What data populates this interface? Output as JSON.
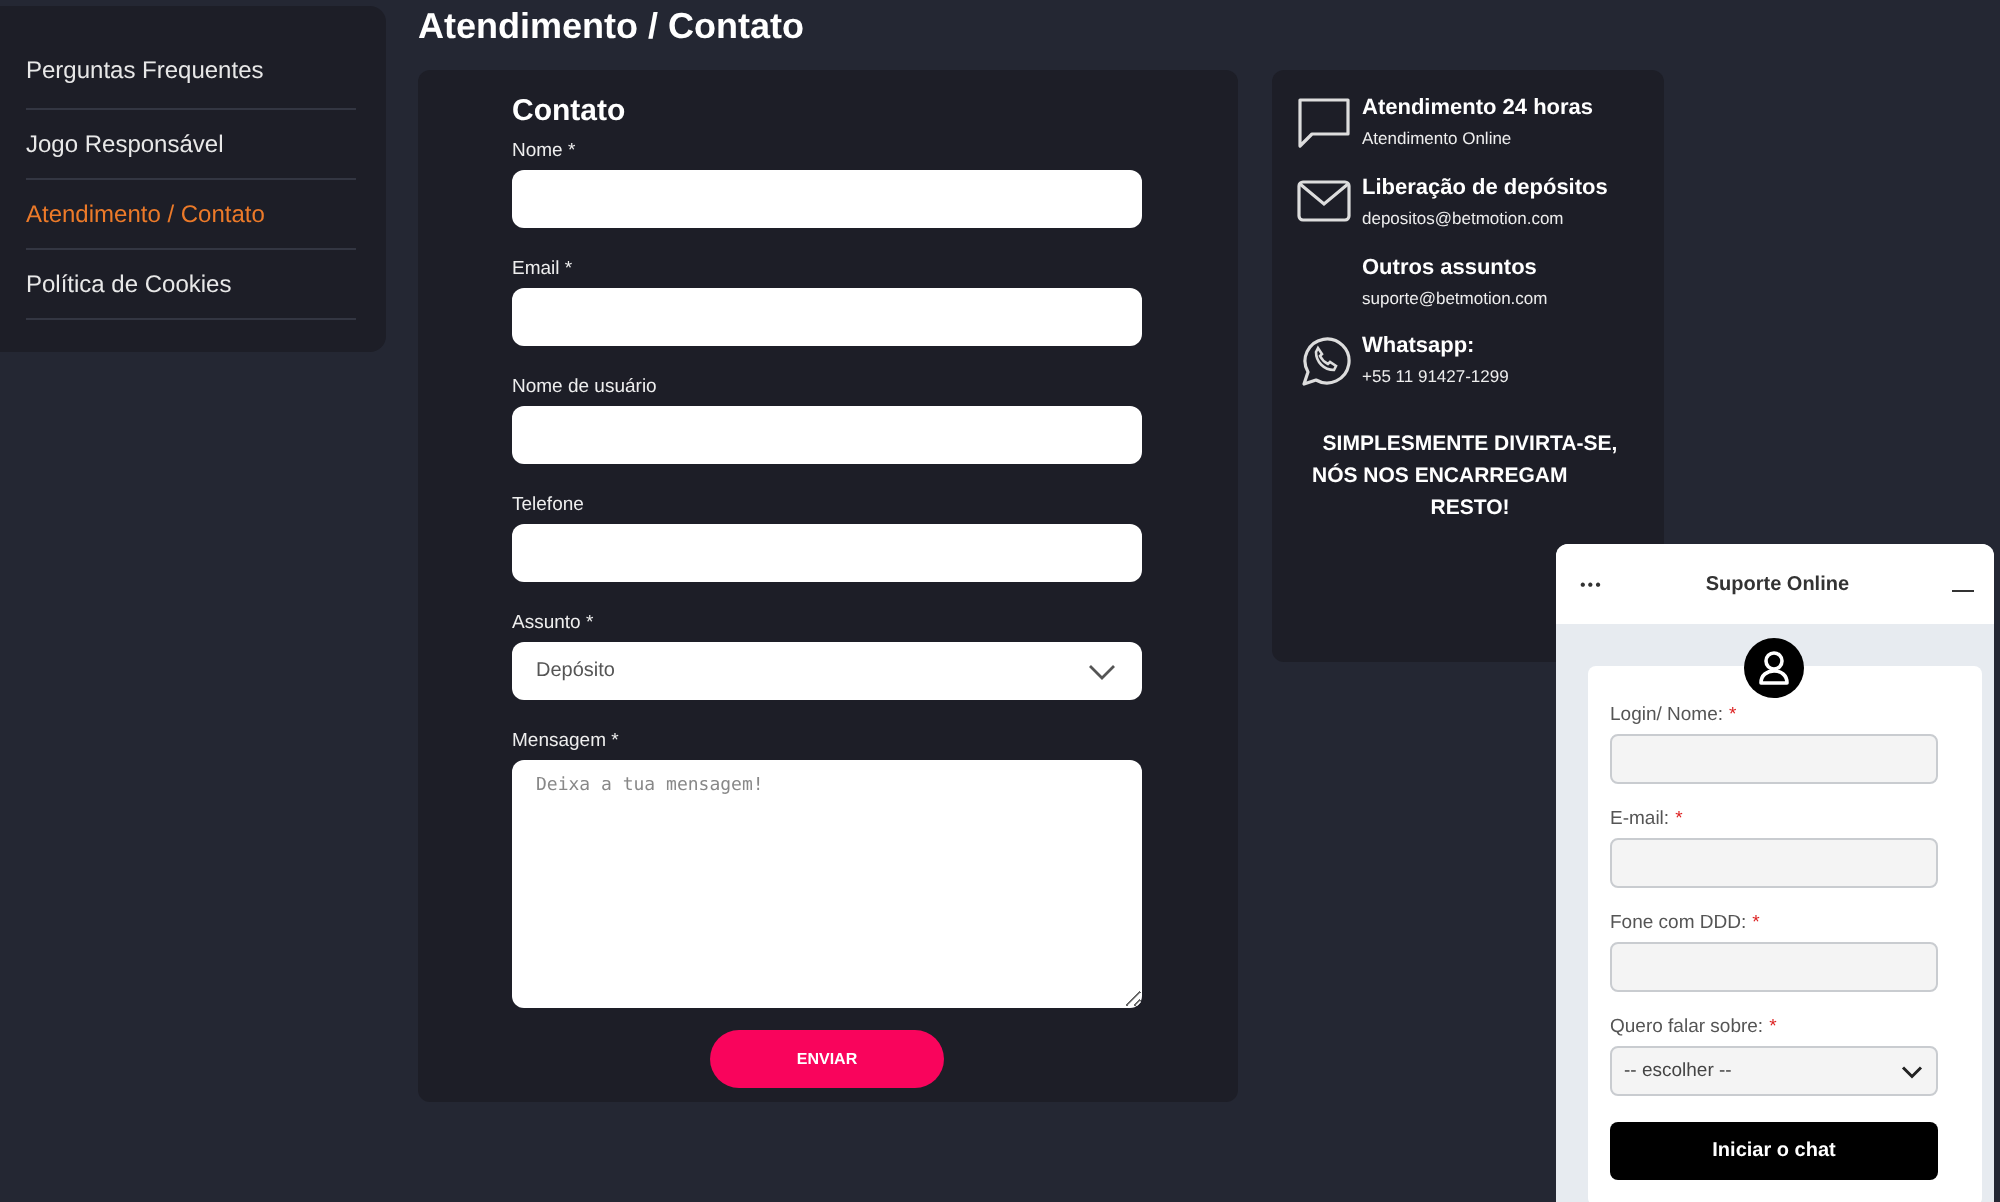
{
  "sidebar": {
    "items": [
      {
        "label": "Perguntas Frequentes",
        "selected": false
      },
      {
        "label": "Jogo Responsável",
        "selected": false
      },
      {
        "label": "Atendimento / Contato",
        "selected": true
      },
      {
        "label": "Política de Cookies",
        "selected": false
      }
    ]
  },
  "page_title": "Atendimento / Contato",
  "form": {
    "title": "Contato",
    "fields": [
      {
        "kind": "input",
        "label": "Nome *"
      },
      {
        "kind": "input",
        "label": "Email *"
      },
      {
        "kind": "input",
        "label": "Nome de usuário"
      },
      {
        "kind": "input",
        "label": "Telefone"
      },
      {
        "kind": "select",
        "label": "Assunto *",
        "value": "Depósito"
      },
      {
        "kind": "textarea",
        "label": "Mensagem *",
        "placeholder": "Deixa a tua mensagem!"
      }
    ],
    "submit": "ENVIAR"
  },
  "info": {
    "items": [
      {
        "kind": "chat",
        "title": "Atendimento 24 horas",
        "detail": "Atendimento Online"
      },
      {
        "kind": "mail",
        "title": "Liberação de depósitos",
        "detail": "depositos@betmotion.com"
      },
      {
        "kind": "none",
        "title": "Outros assuntos",
        "detail": "suporte@betmotion.com"
      },
      {
        "kind": "whatsapp",
        "title": "Whatsapp:",
        "detail": "+55 11 91427-1299"
      }
    ],
    "slogan": [
      "SIMPLESMENTE DIVIRTA-SE,",
      "NÓS NOS ENCARREGAM",
      "RESTO!"
    ]
  },
  "chat_widget": {
    "menu": "•••",
    "title": "Suporte Online",
    "fields": [
      {
        "kind": "input",
        "label": "Login/ Nome:",
        "mark": "*"
      },
      {
        "kind": "input",
        "label": "E-mail:",
        "mark": "*"
      },
      {
        "kind": "input",
        "label": "Fone com DDD:",
        "mark": "*"
      },
      {
        "kind": "select",
        "label": "Quero falar sobre:",
        "mark": "*",
        "value": "-- escolher --"
      }
    ],
    "submit": "Iniciar o chat"
  }
}
